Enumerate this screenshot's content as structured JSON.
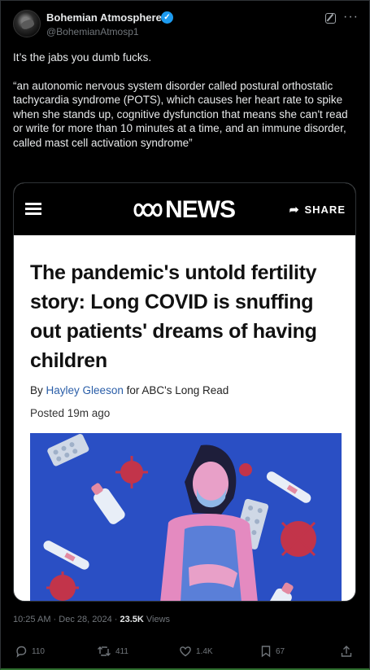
{
  "author": {
    "name": "Bohemian Atmosphere",
    "handle": "@BohemianAtmosp1",
    "verified_icon": "verified-badge-icon"
  },
  "tweet": {
    "line1": "It’s the jabs you dumb fucks.",
    "quote": "“an autonomic nervous system disorder called postural orthostatic tachycardia syndrome (POTS), which causes her heart rate to spike when she stands up, cognitive dysfunction that means she can't read or write for more than 10 minutes at a time, and an immune disorder, called mast cell activation syndrome”"
  },
  "card": {
    "logo_text": "NEWS",
    "share_label": "SHARE",
    "headline": "The pandemic's untold fertility story: Long COVID is snuffing out patients' dreams of having children",
    "byline_prefix": "By",
    "byline_author": "Hayley Gleeson",
    "byline_suffix": "for ABC's Long Read",
    "posted": "Posted 19m ago"
  },
  "meta": {
    "time_date": "10:25 AM · Dec 28, 2024 · ",
    "views_count": "23.5K",
    "views_label": " Views"
  },
  "actions": {
    "replies": "110",
    "reposts": "411",
    "likes": "1.4K",
    "bookmarks": "67"
  },
  "colors": {
    "background": "#000000",
    "text": "#e7e9ea",
    "muted": "#71767b",
    "verified": "#1d9bf0",
    "link": "#2a5ea8",
    "illustration_bg": "#2a4fc4"
  }
}
